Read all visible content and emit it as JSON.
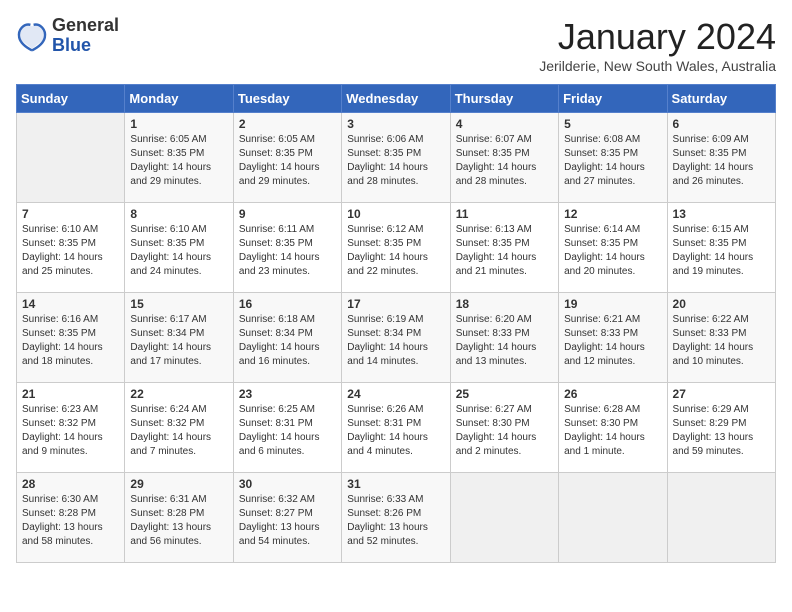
{
  "header": {
    "logo_line1": "General",
    "logo_line2": "Blue",
    "title": "January 2024",
    "subtitle": "Jerilderie, New South Wales, Australia"
  },
  "calendar": {
    "weekdays": [
      "Sunday",
      "Monday",
      "Tuesday",
      "Wednesday",
      "Thursday",
      "Friday",
      "Saturday"
    ],
    "weeks": [
      [
        {
          "day": "",
          "empty": true
        },
        {
          "day": "1",
          "sunrise": "6:05 AM",
          "sunset": "8:35 PM",
          "daylight": "14 hours and 29 minutes."
        },
        {
          "day": "2",
          "sunrise": "6:05 AM",
          "sunset": "8:35 PM",
          "daylight": "14 hours and 29 minutes."
        },
        {
          "day": "3",
          "sunrise": "6:06 AM",
          "sunset": "8:35 PM",
          "daylight": "14 hours and 28 minutes."
        },
        {
          "day": "4",
          "sunrise": "6:07 AM",
          "sunset": "8:35 PM",
          "daylight": "14 hours and 28 minutes."
        },
        {
          "day": "5",
          "sunrise": "6:08 AM",
          "sunset": "8:35 PM",
          "daylight": "14 hours and 27 minutes."
        },
        {
          "day": "6",
          "sunrise": "6:09 AM",
          "sunset": "8:35 PM",
          "daylight": "14 hours and 26 minutes."
        }
      ],
      [
        {
          "day": "7",
          "sunrise": "6:10 AM",
          "sunset": "8:35 PM",
          "daylight": "14 hours and 25 minutes."
        },
        {
          "day": "8",
          "sunrise": "6:10 AM",
          "sunset": "8:35 PM",
          "daylight": "14 hours and 24 minutes."
        },
        {
          "day": "9",
          "sunrise": "6:11 AM",
          "sunset": "8:35 PM",
          "daylight": "14 hours and 23 minutes."
        },
        {
          "day": "10",
          "sunrise": "6:12 AM",
          "sunset": "8:35 PM",
          "daylight": "14 hours and 22 minutes."
        },
        {
          "day": "11",
          "sunrise": "6:13 AM",
          "sunset": "8:35 PM",
          "daylight": "14 hours and 21 minutes."
        },
        {
          "day": "12",
          "sunrise": "6:14 AM",
          "sunset": "8:35 PM",
          "daylight": "14 hours and 20 minutes."
        },
        {
          "day": "13",
          "sunrise": "6:15 AM",
          "sunset": "8:35 PM",
          "daylight": "14 hours and 19 minutes."
        }
      ],
      [
        {
          "day": "14",
          "sunrise": "6:16 AM",
          "sunset": "8:35 PM",
          "daylight": "14 hours and 18 minutes."
        },
        {
          "day": "15",
          "sunrise": "6:17 AM",
          "sunset": "8:34 PM",
          "daylight": "14 hours and 17 minutes."
        },
        {
          "day": "16",
          "sunrise": "6:18 AM",
          "sunset": "8:34 PM",
          "daylight": "14 hours and 16 minutes."
        },
        {
          "day": "17",
          "sunrise": "6:19 AM",
          "sunset": "8:34 PM",
          "daylight": "14 hours and 14 minutes."
        },
        {
          "day": "18",
          "sunrise": "6:20 AM",
          "sunset": "8:33 PM",
          "daylight": "14 hours and 13 minutes."
        },
        {
          "day": "19",
          "sunrise": "6:21 AM",
          "sunset": "8:33 PM",
          "daylight": "14 hours and 12 minutes."
        },
        {
          "day": "20",
          "sunrise": "6:22 AM",
          "sunset": "8:33 PM",
          "daylight": "14 hours and 10 minutes."
        }
      ],
      [
        {
          "day": "21",
          "sunrise": "6:23 AM",
          "sunset": "8:32 PM",
          "daylight": "14 hours and 9 minutes."
        },
        {
          "day": "22",
          "sunrise": "6:24 AM",
          "sunset": "8:32 PM",
          "daylight": "14 hours and 7 minutes."
        },
        {
          "day": "23",
          "sunrise": "6:25 AM",
          "sunset": "8:31 PM",
          "daylight": "14 hours and 6 minutes."
        },
        {
          "day": "24",
          "sunrise": "6:26 AM",
          "sunset": "8:31 PM",
          "daylight": "14 hours and 4 minutes."
        },
        {
          "day": "25",
          "sunrise": "6:27 AM",
          "sunset": "8:30 PM",
          "daylight": "14 hours and 2 minutes."
        },
        {
          "day": "26",
          "sunrise": "6:28 AM",
          "sunset": "8:30 PM",
          "daylight": "14 hours and 1 minute."
        },
        {
          "day": "27",
          "sunrise": "6:29 AM",
          "sunset": "8:29 PM",
          "daylight": "13 hours and 59 minutes."
        }
      ],
      [
        {
          "day": "28",
          "sunrise": "6:30 AM",
          "sunset": "8:28 PM",
          "daylight": "13 hours and 58 minutes."
        },
        {
          "day": "29",
          "sunrise": "6:31 AM",
          "sunset": "8:28 PM",
          "daylight": "13 hours and 56 minutes."
        },
        {
          "day": "30",
          "sunrise": "6:32 AM",
          "sunset": "8:27 PM",
          "daylight": "13 hours and 54 minutes."
        },
        {
          "day": "31",
          "sunrise": "6:33 AM",
          "sunset": "8:26 PM",
          "daylight": "13 hours and 52 minutes."
        },
        {
          "day": "",
          "empty": true
        },
        {
          "day": "",
          "empty": true
        },
        {
          "day": "",
          "empty": true
        }
      ]
    ]
  }
}
